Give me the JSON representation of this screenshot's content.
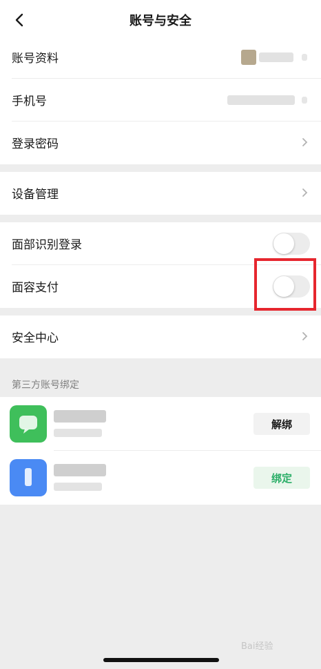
{
  "header": {
    "title": "账号与安全"
  },
  "account_group": [
    {
      "label": "账号资料"
    },
    {
      "label": "手机号"
    },
    {
      "label": "登录密码"
    }
  ],
  "device_group": {
    "label": "设备管理"
  },
  "face_group": [
    {
      "label": "面部识别登录",
      "enabled": false
    },
    {
      "label": "面容支付",
      "enabled": false
    }
  ],
  "security_group": {
    "label": "安全中心"
  },
  "third_party": {
    "section_title": "第三方账号绑定",
    "items": [
      {
        "action_label": "解绑",
        "icon_color": "#3fbf5b"
      },
      {
        "action_label": "绑定",
        "icon_color": "#4a8af4"
      }
    ]
  },
  "watermark": "Bai经验",
  "colors": {
    "highlight": "#e6262e",
    "bind_green": "#2aae67"
  }
}
